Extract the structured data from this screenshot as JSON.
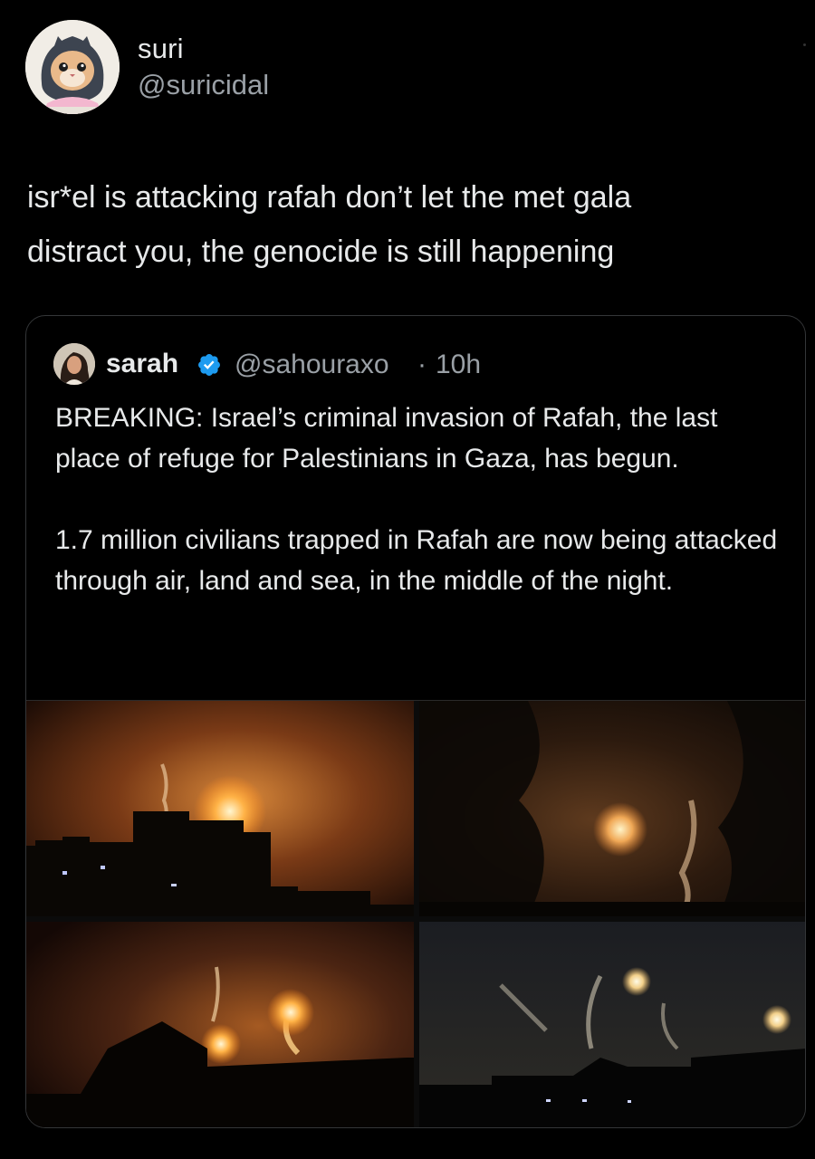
{
  "tweet": {
    "author": {
      "display_name": "suri",
      "handle": "@suricidal"
    },
    "text": "isr*el is attacking rafah don’t let the met gala\ndistract you, the genocide is still happening"
  },
  "quoted_tweet": {
    "author": {
      "display_name": "sarah",
      "handle": "@sahouraxo",
      "verified": true
    },
    "separator": "·",
    "time": "10h",
    "paragraphs": [
      "BREAKING: Israel’s criminal invasion of Rafah, the last place of refuge for Palestinians in Gaza, has begun.",
      "1.7 million civilians trapped in Rafah are now being attacked through air, land and sea, in the middle of the night."
    ],
    "media_count": 4
  },
  "colors": {
    "background": "#000000",
    "text": "#e7e9ea",
    "secondary_text": "#9aa0a6",
    "verified_blue": "#1d9bf0",
    "card_border": "#343638"
  },
  "icons": {
    "verified": "verified-badge-icon",
    "avatar": "kitten-avatar",
    "quote_avatar": "portrait-avatar"
  }
}
